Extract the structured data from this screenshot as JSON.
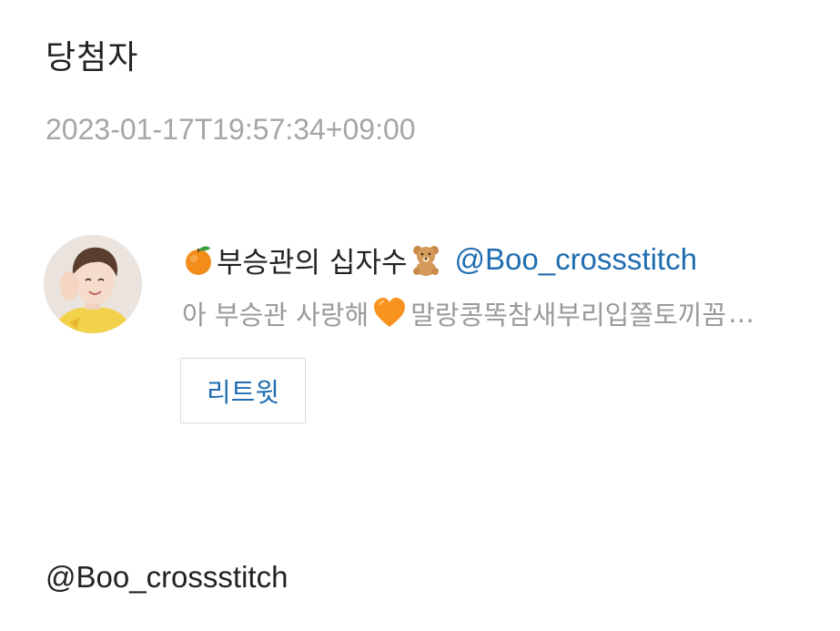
{
  "header": {
    "title": "당첨자",
    "timestamp": "2023-01-17T19:57:34+09:00"
  },
  "tweet": {
    "avatar_icon": "profile-photo",
    "leading_emoji_icon": "tangerine-icon",
    "display_name": "부승관의 십자수",
    "trailing_emoji_icon": "teddy-bear-icon",
    "handle": "@Boo_crossstitch",
    "preview_start": "아 부승관 사랑해",
    "preview_heart_icon": "orange-heart-icon",
    "preview_end": "말랑콩똑참새부리입쫄토끼꼼",
    "preview_ellipsis": "…",
    "retweet_label": "리트윗"
  },
  "footer": {
    "handle": "@Boo_crossstitch"
  },
  "colors": {
    "text": "#222222",
    "muted": "#a6a6a6",
    "link": "#1f6db0",
    "border": "#dcdcdc"
  }
}
